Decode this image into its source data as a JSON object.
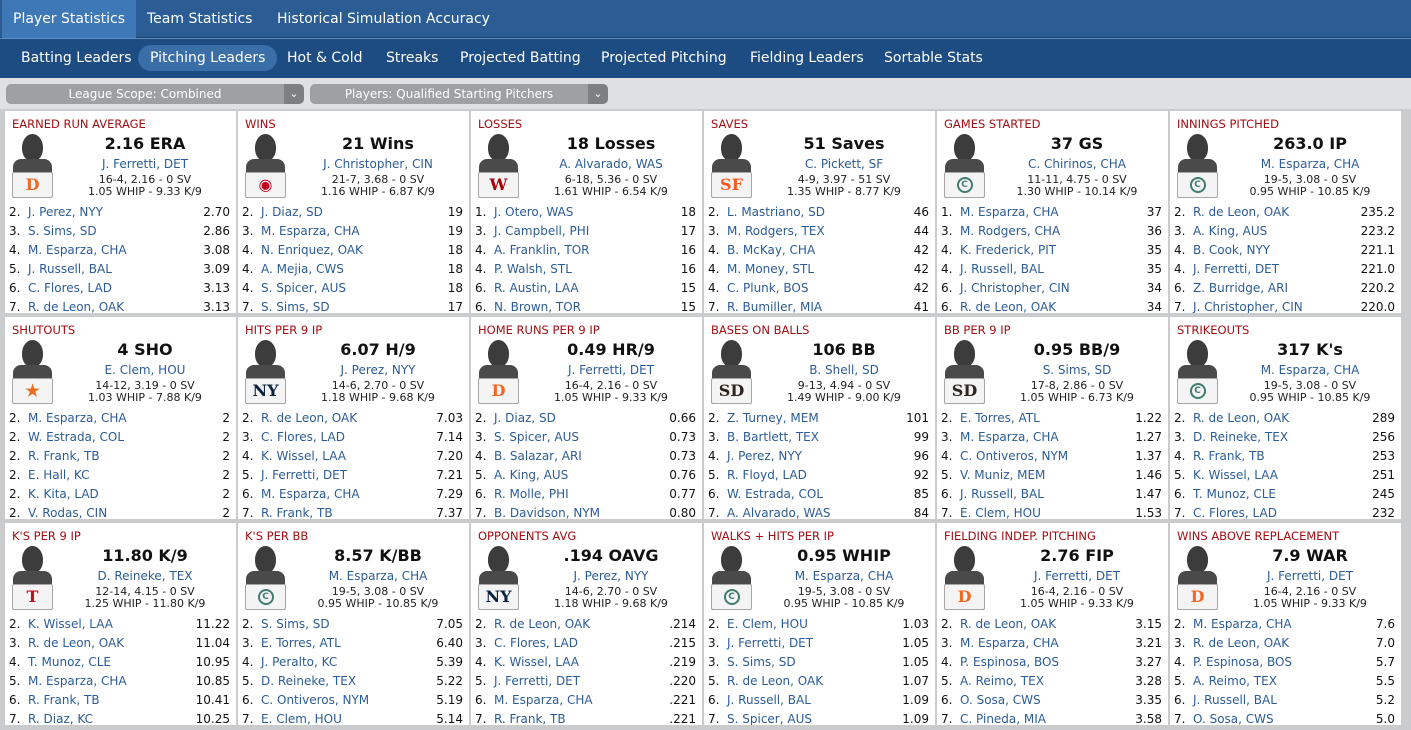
{
  "top_tabs": [
    "Player Statistics",
    "Team Statistics",
    "Historical Simulation Accuracy"
  ],
  "sub_tabs": [
    "Batting Leaders",
    "Pitching Leaders",
    "Hot & Cold",
    "Streaks",
    "Projected Batting",
    "Projected Pitching",
    "Fielding Leaders",
    "Sortable Stats"
  ],
  "filters": {
    "scope": "League Scope: Combined",
    "players": "Players: Qualified Starting Pitchers",
    "arrow": "⌄"
  },
  "cards": [
    {
      "title": "EARNED RUN AVERAGE",
      "value": "2.16 ERA",
      "name": "J. Ferretti, DET",
      "line1": "16-4, 2.16 - 0 SV",
      "line2": "1.05 WHIP - 9.33 K/9",
      "logo": {
        "glyph": "D",
        "color": "#f26722"
      },
      "rows": [
        [
          "2.",
          "J. Perez, NYY",
          "2.70"
        ],
        [
          "3.",
          "S. Sims, SD",
          "2.86"
        ],
        [
          "4.",
          "M. Esparza, CHA",
          "3.08"
        ],
        [
          "5.",
          "J. Russell, BAL",
          "3.09"
        ],
        [
          "6.",
          "C. Flores, LAD",
          "3.13"
        ],
        [
          "7.",
          "R. de Leon, OAK",
          "3.13"
        ]
      ]
    },
    {
      "title": "WINS",
      "value": "21 Wins",
      "name": "J. Christopher, CIN",
      "line1": "21-7, 3.68 - 0 SV",
      "line2": "1.16 WHIP - 6.87 K/9",
      "logo": {
        "glyph": "◉",
        "color": "#c6011f"
      },
      "rows": [
        [
          "2.",
          "J. Diaz, SD",
          "19"
        ],
        [
          "3.",
          "M. Esparza, CHA",
          "19"
        ],
        [
          "4.",
          "N. Enriquez, OAK",
          "18"
        ],
        [
          "4.",
          "A. Mejia, CWS",
          "18"
        ],
        [
          "4.",
          "S. Spicer, AUS",
          "18"
        ],
        [
          "7.",
          "S. Sims, SD",
          "17"
        ]
      ]
    },
    {
      "title": "LOSSES",
      "value": "18 Losses",
      "name": "A. Alvarado, WAS",
      "line1": "6-18, 5.36 - 0 SV",
      "line2": "1.61 WHIP - 6.54 K/9",
      "logo": {
        "glyph": "W",
        "color": "#ab0003"
      },
      "rows": [
        [
          "1.",
          "J. Otero, WAS",
          "18"
        ],
        [
          "3.",
          "J. Campbell, PHI",
          "17"
        ],
        [
          "4.",
          "A. Franklin, TOR",
          "16"
        ],
        [
          "4.",
          "P. Walsh, STL",
          "16"
        ],
        [
          "6.",
          "R. Austin, LAA",
          "15"
        ],
        [
          "6.",
          "N. Brown, TOR",
          "15"
        ]
      ]
    },
    {
      "title": "SAVES",
      "value": "51 Saves",
      "name": "C. Pickett, SF",
      "line1": "4-9, 3.97 - 51 SV",
      "line2": "1.35 WHIP - 8.77 K/9",
      "logo": {
        "glyph": "SF",
        "color": "#fd5a1e"
      },
      "rows": [
        [
          "2.",
          "L. Mastriano, SD",
          "46"
        ],
        [
          "3.",
          "M. Rodgers, TEX",
          "44"
        ],
        [
          "4.",
          "B. McKay, CHA",
          "42"
        ],
        [
          "4.",
          "M. Money, STL",
          "42"
        ],
        [
          "4.",
          "C. Plunk, BOS",
          "42"
        ],
        [
          "7.",
          "R. Bumiller, MIA",
          "41"
        ]
      ]
    },
    {
      "title": "GAMES STARTED",
      "value": "37 GS",
      "name": "C. Chirinos, CHA",
      "line1": "11-11, 4.75 - 0 SV",
      "line2": "1.30 WHIP - 10.14 K/9",
      "logo": {
        "glyph": "C",
        "color": "#3f7d6f",
        "circle": true
      },
      "rows": [
        [
          "1.",
          "M. Esparza, CHA",
          "37"
        ],
        [
          "3.",
          "M. Rodgers, CHA",
          "36"
        ],
        [
          "4.",
          "K. Frederick, PIT",
          "35"
        ],
        [
          "4.",
          "J. Russell, BAL",
          "35"
        ],
        [
          "6.",
          "J. Christopher, CIN",
          "34"
        ],
        [
          "6.",
          "R. de Leon, OAK",
          "34"
        ]
      ]
    },
    {
      "title": "INNINGS PITCHED",
      "value": "263.0 IP",
      "name": "M. Esparza, CHA",
      "line1": "19-5, 3.08 - 0 SV",
      "line2": "0.95 WHIP - 10.85 K/9",
      "logo": {
        "glyph": "C",
        "color": "#3f7d6f",
        "circle": true
      },
      "rows": [
        [
          "2.",
          "R. de Leon, OAK",
          "235.2"
        ],
        [
          "3.",
          "A. King, AUS",
          "223.2"
        ],
        [
          "4.",
          "B. Cook, NYY",
          "221.1"
        ],
        [
          "4.",
          "J. Ferretti, DET",
          "221.0"
        ],
        [
          "6.",
          "Z. Burridge, ARI",
          "220.2"
        ],
        [
          "7.",
          "J. Christopher, CIN",
          "220.0"
        ]
      ]
    },
    {
      "title": "SHUTOUTS",
      "value": "4 SHO",
      "name": "E. Clem, HOU",
      "line1": "14-12, 3.19 - 0 SV",
      "line2": "1.03 WHIP - 7.88 K/9",
      "logo": {
        "glyph": "★",
        "color": "#eb6e1f"
      },
      "rows": [
        [
          "2.",
          "M. Esparza, CHA",
          "2"
        ],
        [
          "2.",
          "W. Estrada, COL",
          "2"
        ],
        [
          "2.",
          "R. Frank, TB",
          "2"
        ],
        [
          "2.",
          "E. Hall, KC",
          "2"
        ],
        [
          "2.",
          "K. Kita, LAD",
          "2"
        ],
        [
          "2.",
          "V. Rodas, CIN",
          "2"
        ]
      ]
    },
    {
      "title": "HITS PER 9 IP",
      "value": "6.07 H/9",
      "name": "J. Perez, NYY",
      "line1": "14-6, 2.70 - 0 SV",
      "line2": "1.18 WHIP - 9.68 K/9",
      "logo": {
        "glyph": "NY",
        "color": "#0c2340"
      },
      "rows": [
        [
          "2.",
          "R. de Leon, OAK",
          "7.03"
        ],
        [
          "3.",
          "C. Flores, LAD",
          "7.14"
        ],
        [
          "4.",
          "K. Wissel, LAA",
          "7.20"
        ],
        [
          "5.",
          "J. Ferretti, DET",
          "7.21"
        ],
        [
          "6.",
          "M. Esparza, CHA",
          "7.29"
        ],
        [
          "7.",
          "R. Frank, TB",
          "7.37"
        ]
      ]
    },
    {
      "title": "HOME RUNS PER 9 IP",
      "value": "0.49 HR/9",
      "name": "J. Ferretti, DET",
      "line1": "16-4, 2.16 - 0 SV",
      "line2": "1.05 WHIP - 9.33 K/9",
      "logo": {
        "glyph": "D",
        "color": "#f26722"
      },
      "rows": [
        [
          "2.",
          "J. Diaz, SD",
          "0.66"
        ],
        [
          "3.",
          "S. Spicer, AUS",
          "0.73"
        ],
        [
          "4.",
          "B. Salazar, ARI",
          "0.73"
        ],
        [
          "5.",
          "A. King, AUS",
          "0.76"
        ],
        [
          "6.",
          "R. Molle, PHI",
          "0.77"
        ],
        [
          "7.",
          "B. Davidson, NYM",
          "0.80"
        ]
      ]
    },
    {
      "title": "BASES ON BALLS",
      "value": "106 BB",
      "name": "B. Shell, SD",
      "line1": "9-13, 4.94 - 0 SV",
      "line2": "1.49 WHIP - 9.00 K/9",
      "logo": {
        "glyph": "SD",
        "color": "#2f241d"
      },
      "rows": [
        [
          "2.",
          "Z. Turney, MEM",
          "101"
        ],
        [
          "3.",
          "B. Bartlett, TEX",
          "99"
        ],
        [
          "4.",
          "J. Perez, NYY",
          "96"
        ],
        [
          "5.",
          "R. Floyd, LAD",
          "92"
        ],
        [
          "6.",
          "W. Estrada, COL",
          "85"
        ],
        [
          "7.",
          "A. Alvarado, WAS",
          "84"
        ]
      ]
    },
    {
      "title": "BB PER 9 IP",
      "value": "0.95 BB/9",
      "name": "S. Sims, SD",
      "line1": "17-8, 2.86 - 0 SV",
      "line2": "1.05 WHIP - 6.73 K/9",
      "logo": {
        "glyph": "SD",
        "color": "#2f241d"
      },
      "rows": [
        [
          "2.",
          "E. Torres, ATL",
          "1.22"
        ],
        [
          "3.",
          "M. Esparza, CHA",
          "1.27"
        ],
        [
          "4.",
          "C. Ontiveros, NYM",
          "1.37"
        ],
        [
          "5.",
          "V. Muniz, MEM",
          "1.46"
        ],
        [
          "6.",
          "J. Russell, BAL",
          "1.47"
        ],
        [
          "7.",
          "E. Clem, HOU",
          "1.53"
        ]
      ]
    },
    {
      "title": "STRIKEOUTS",
      "value": "317 K's",
      "name": "M. Esparza, CHA",
      "line1": "19-5, 3.08 - 0 SV",
      "line2": "0.95 WHIP - 10.85 K/9",
      "logo": {
        "glyph": "C",
        "color": "#3f7d6f",
        "circle": true
      },
      "rows": [
        [
          "2.",
          "R. de Leon, OAK",
          "289"
        ],
        [
          "3.",
          "D. Reineke, TEX",
          "256"
        ],
        [
          "4.",
          "R. Frank, TB",
          "253"
        ],
        [
          "5.",
          "K. Wissel, LAA",
          "251"
        ],
        [
          "6.",
          "T. Munoz, CLE",
          "245"
        ],
        [
          "7.",
          "C. Flores, LAD",
          "232"
        ]
      ]
    },
    {
      "title": "K'S PER 9 IP",
      "value": "11.80 K/9",
      "name": "D. Reineke, TEX",
      "line1": "12-14, 4.15 - 0 SV",
      "line2": "1.25 WHIP - 11.80 K/9",
      "logo": {
        "glyph": "T",
        "color": "#c0111f"
      },
      "rows": [
        [
          "2.",
          "K. Wissel, LAA",
          "11.22"
        ],
        [
          "3.",
          "R. de Leon, OAK",
          "11.04"
        ],
        [
          "4.",
          "T. Munoz, CLE",
          "10.95"
        ],
        [
          "5.",
          "M. Esparza, CHA",
          "10.85"
        ],
        [
          "6.",
          "R. Frank, TB",
          "10.41"
        ],
        [
          "7.",
          "R. Diaz, KC",
          "10.25"
        ]
      ]
    },
    {
      "title": "K'S PER BB",
      "value": "8.57 K/BB",
      "name": "M. Esparza, CHA",
      "line1": "19-5, 3.08 - 0 SV",
      "line2": "0.95 WHIP - 10.85 K/9",
      "logo": {
        "glyph": "C",
        "color": "#3f7d6f",
        "circle": true
      },
      "rows": [
        [
          "2.",
          "S. Sims, SD",
          "7.05"
        ],
        [
          "3.",
          "E. Torres, ATL",
          "6.40"
        ],
        [
          "4.",
          "J. Peralto, KC",
          "5.39"
        ],
        [
          "5.",
          "D. Reineke, TEX",
          "5.22"
        ],
        [
          "6.",
          "C. Ontiveros, NYM",
          "5.19"
        ],
        [
          "7.",
          "E. Clem, HOU",
          "5.14"
        ]
      ]
    },
    {
      "title": "OPPONENTS AVG",
      "value": ".194 OAVG",
      "name": "J. Perez, NYY",
      "line1": "14-6, 2.70 - 0 SV",
      "line2": "1.18 WHIP - 9.68 K/9",
      "logo": {
        "glyph": "NY",
        "color": "#0c2340"
      },
      "rows": [
        [
          "2.",
          "R. de Leon, OAK",
          ".214"
        ],
        [
          "3.",
          "C. Flores, LAD",
          ".215"
        ],
        [
          "4.",
          "K. Wissel, LAA",
          ".219"
        ],
        [
          "5.",
          "J. Ferretti, DET",
          ".220"
        ],
        [
          "6.",
          "M. Esparza, CHA",
          ".221"
        ],
        [
          "7.",
          "R. Frank, TB",
          ".221"
        ]
      ]
    },
    {
      "title": "WALKS + HITS PER IP",
      "value": "0.95 WHIP",
      "name": "M. Esparza, CHA",
      "line1": "19-5, 3.08 - 0 SV",
      "line2": "0.95 WHIP - 10.85 K/9",
      "logo": {
        "glyph": "C",
        "color": "#3f7d6f",
        "circle": true
      },
      "rows": [
        [
          "2.",
          "E. Clem, HOU",
          "1.03"
        ],
        [
          "3.",
          "J. Ferretti, DET",
          "1.05"
        ],
        [
          "3.",
          "S. Sims, SD",
          "1.05"
        ],
        [
          "5.",
          "R. de Leon, OAK",
          "1.07"
        ],
        [
          "6.",
          "J. Russell, BAL",
          "1.09"
        ],
        [
          "7.",
          "S. Spicer, AUS",
          "1.09"
        ]
      ]
    },
    {
      "title": "FIELDING INDEP. PITCHING",
      "value": "2.76 FIP",
      "name": "J. Ferretti, DET",
      "line1": "16-4, 2.16 - 0 SV",
      "line2": "1.05 WHIP - 9.33 K/9",
      "logo": {
        "glyph": "D",
        "color": "#f26722"
      },
      "rows": [
        [
          "2.",
          "R. de Leon, OAK",
          "3.15"
        ],
        [
          "3.",
          "M. Esparza, CHA",
          "3.21"
        ],
        [
          "4.",
          "P. Espinosa, BOS",
          "3.27"
        ],
        [
          "5.",
          "A. Reimo, TEX",
          "3.28"
        ],
        [
          "6.",
          "O. Sosa, CWS",
          "3.35"
        ],
        [
          "7.",
          "C. Pineda, MIA",
          "3.58"
        ]
      ]
    },
    {
      "title": "WINS ABOVE REPLACEMENT",
      "value": "7.9 WAR",
      "name": "J. Ferretti, DET",
      "line1": "16-4, 2.16 - 0 SV",
      "line2": "1.05 WHIP - 9.33 K/9",
      "logo": {
        "glyph": "D",
        "color": "#f26722"
      },
      "rows": [
        [
          "2.",
          "M. Esparza, CHA",
          "7.6"
        ],
        [
          "3.",
          "R. de Leon, OAK",
          "7.0"
        ],
        [
          "4.",
          "P. Espinosa, BOS",
          "5.7"
        ],
        [
          "5.",
          "A. Reimo, TEX",
          "5.5"
        ],
        [
          "6.",
          "J. Russell, BAL",
          "5.2"
        ],
        [
          "7.",
          "O. Sosa, CWS",
          "5.0"
        ]
      ]
    }
  ]
}
